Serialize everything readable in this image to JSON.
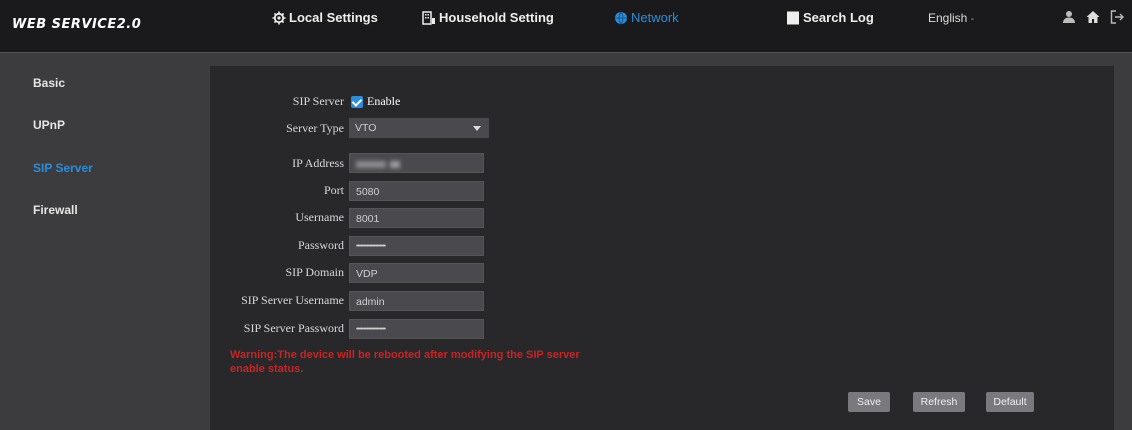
{
  "header": {
    "logo": "WEB SERVICE2.0",
    "nav": [
      {
        "label": "Local Settings",
        "icon": "gear-icon"
      },
      {
        "label": "Household Setting",
        "icon": "building-icon"
      },
      {
        "label": "Network",
        "icon": "globe-icon"
      },
      {
        "label": "Search Log",
        "icon": "document-icon"
      }
    ],
    "language": "English",
    "icons": [
      "user-icon",
      "home-icon",
      "logout-icon"
    ]
  },
  "sidebar": {
    "items": [
      {
        "label": "Basic"
      },
      {
        "label": "UPnP"
      },
      {
        "label": "SIP Server"
      },
      {
        "label": "Firewall"
      }
    ]
  },
  "form": {
    "sip_server_label": "SIP Server",
    "enable_label": "Enable",
    "enable_checked": true,
    "server_type_label": "Server Type",
    "server_type_value": "VTO",
    "ip_address_label": "IP Address",
    "port_label": "Port",
    "port_value": "5080",
    "username_label": "Username",
    "username_value": "8001",
    "password_label": "Password",
    "password_value": "••••••••••••••••••••",
    "sip_domain_label": "SIP Domain",
    "sip_domain_value": "VDP",
    "sip_server_username_label": "SIP Server Username",
    "sip_server_username_value": "admin",
    "sip_server_password_label": "SIP Server Password",
    "sip_server_password_value": "••••••••••••••••••••",
    "warning": "Warning:The device will be rebooted after modifying the SIP server enable status."
  },
  "buttons": {
    "save": "Save",
    "refresh": "Refresh",
    "default": "Default"
  },
  "colors": {
    "accent": "#2b8dd9",
    "warning": "#c82424",
    "topbar": "#1a1a1c",
    "panel": "#28282b"
  }
}
